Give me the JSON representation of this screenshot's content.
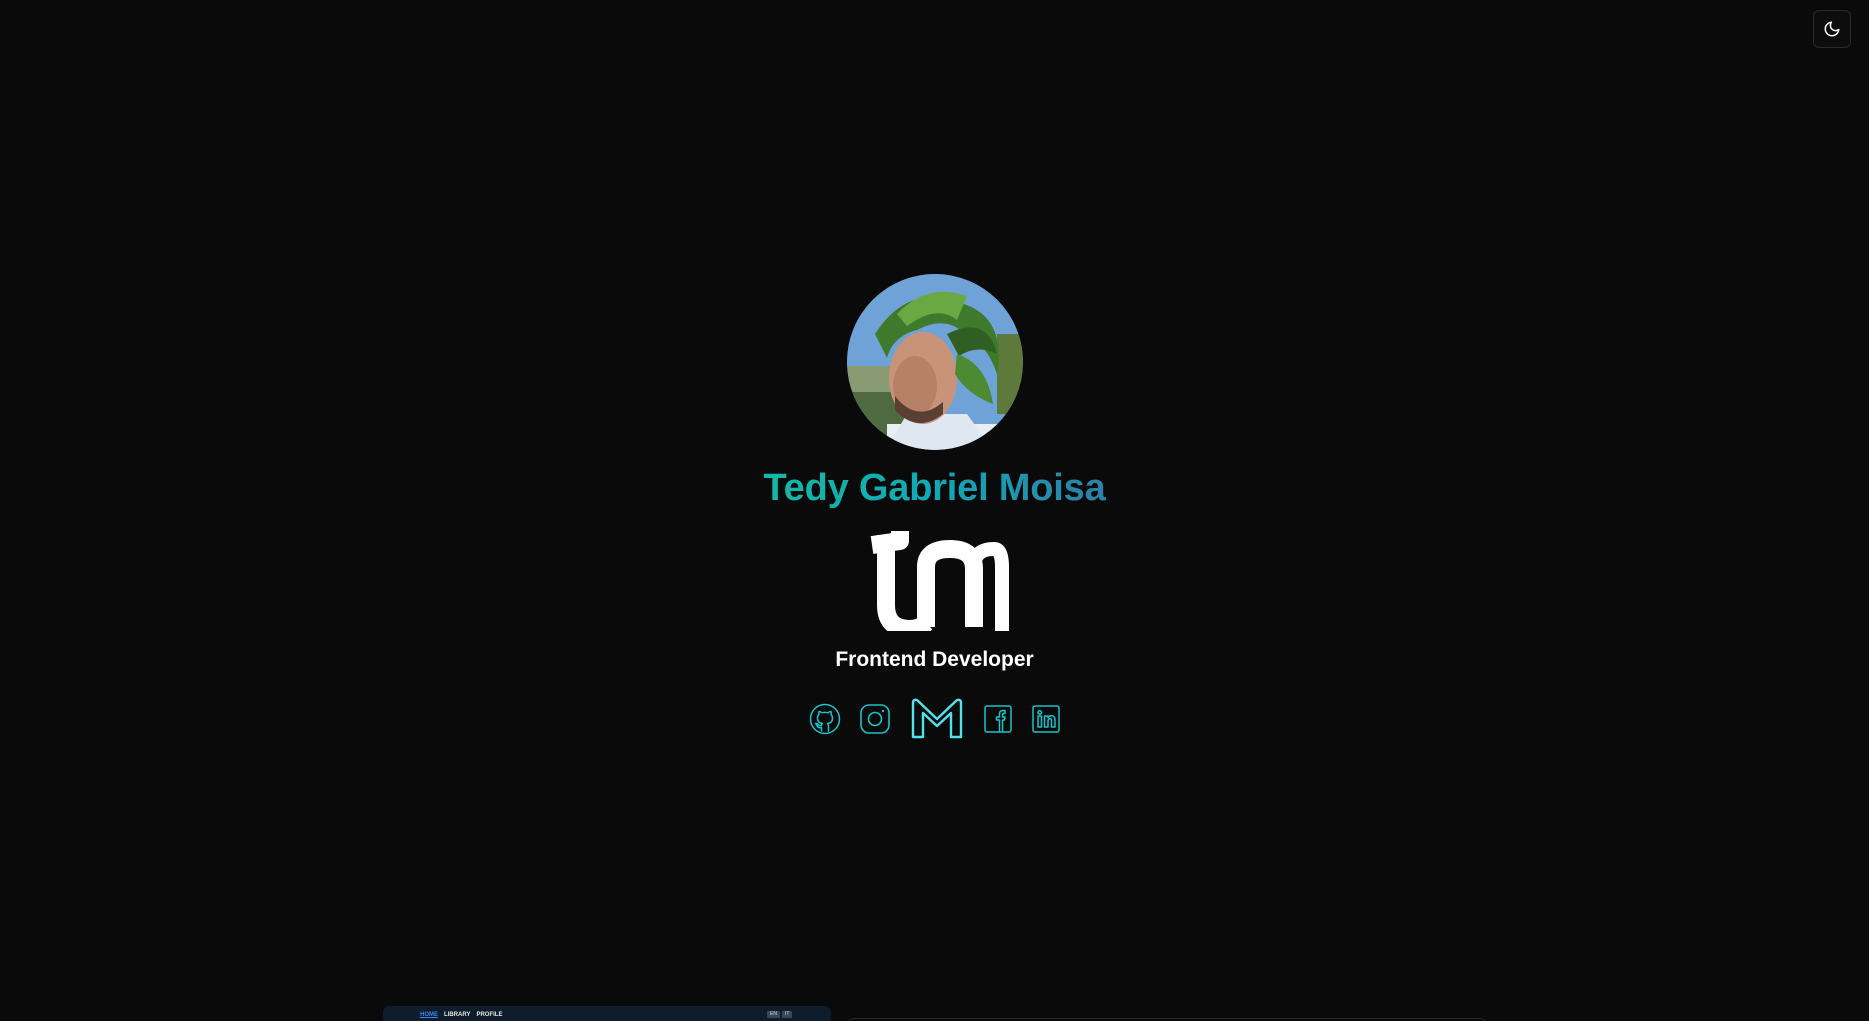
{
  "theme_toggle": {
    "icon": "moon-icon"
  },
  "profile": {
    "avatar_icon": "profile-photo",
    "name": "Tedy Gabriel Moisa",
    "logo_icon": "tm-monogram-logo",
    "role": "Frontend Developer"
  },
  "socials": [
    {
      "icon": "github-icon"
    },
    {
      "icon": "instagram-icon"
    },
    {
      "icon": "gmail-icon"
    },
    {
      "icon": "facebook-icon"
    },
    {
      "icon": "linkedin-icon"
    }
  ],
  "project_preview": {
    "nav": [
      "HOME",
      "LIBRARY",
      "PROFILE"
    ],
    "controls": [
      "EN",
      "IT"
    ]
  },
  "colors": {
    "background": "#0a0a0a",
    "accent": "#14b8a6",
    "icon_stroke": "#17c3cc",
    "gmail_stroke": "#4fe3ee"
  }
}
